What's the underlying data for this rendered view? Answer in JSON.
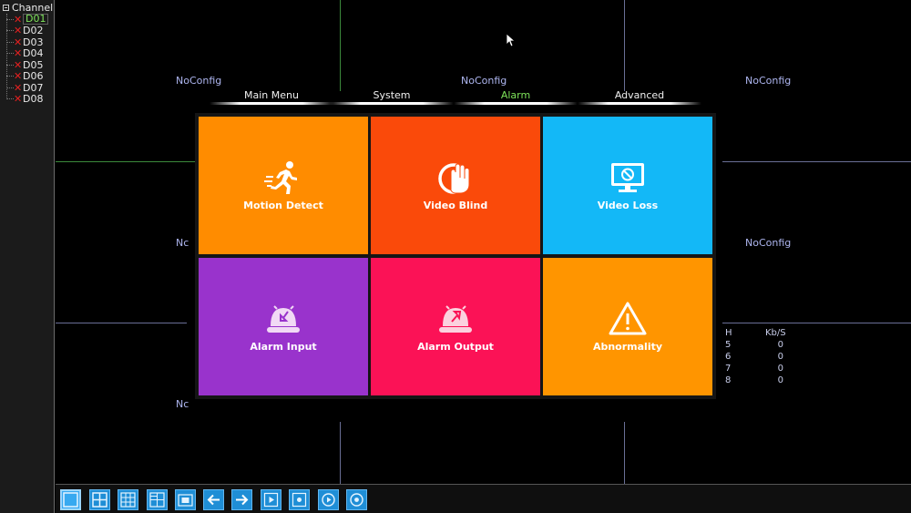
{
  "sidebar": {
    "root_label": "Channel",
    "channels": [
      {
        "label": "D01",
        "selected": true
      },
      {
        "label": "D02"
      },
      {
        "label": "D03"
      },
      {
        "label": "D04"
      },
      {
        "label": "D05"
      },
      {
        "label": "D06"
      },
      {
        "label": "D07"
      },
      {
        "label": "D08"
      }
    ],
    "status_icon": "red-x-icon"
  },
  "video": {
    "noconfig": [
      "NoConfig",
      "NoConfig",
      "NoConfig",
      "Nc",
      "NoConfig",
      "Nc"
    ],
    "bitrate": {
      "header": [
        "H",
        "Kb/S"
      ],
      "rows": [
        [
          "5",
          "0"
        ],
        [
          "6",
          "0"
        ],
        [
          "7",
          "0"
        ],
        [
          "8",
          "0"
        ]
      ]
    }
  },
  "menu": {
    "tabs": [
      {
        "label": "Main Menu"
      },
      {
        "label": "System"
      },
      {
        "label": "Alarm",
        "active": true
      },
      {
        "label": "Advanced"
      }
    ],
    "active_color": "#7ee35a",
    "tiles": [
      {
        "label": "Motion Detect",
        "icon": "running-man-icon",
        "color": "#ff8c00"
      },
      {
        "label": "Video Blind",
        "icon": "hand-blind-icon",
        "color": "#fa4a0a"
      },
      {
        "label": "Video Loss",
        "icon": "monitor-no-signal-icon",
        "color": "#13b8f7"
      },
      {
        "label": "Alarm Input",
        "icon": "alarm-bell-in-icon",
        "color": "#9933cc"
      },
      {
        "label": "Alarm Output",
        "icon": "alarm-bell-out-icon",
        "color": "#fb1256"
      },
      {
        "label": "Abnormality",
        "icon": "warning-triangle-icon",
        "color": "#ff9500"
      }
    ]
  },
  "toolbar": {
    "buttons": [
      "single-view-icon",
      "quad-view-icon",
      "nine-view-icon",
      "sixteen-view-icon",
      "fullscreen-icon",
      "previous-arrow-icon",
      "next-arrow-icon",
      "playback-icon",
      "record-icon",
      "play-circle-icon",
      "target-circle-icon"
    ],
    "button_color": "#1f8ed6"
  }
}
